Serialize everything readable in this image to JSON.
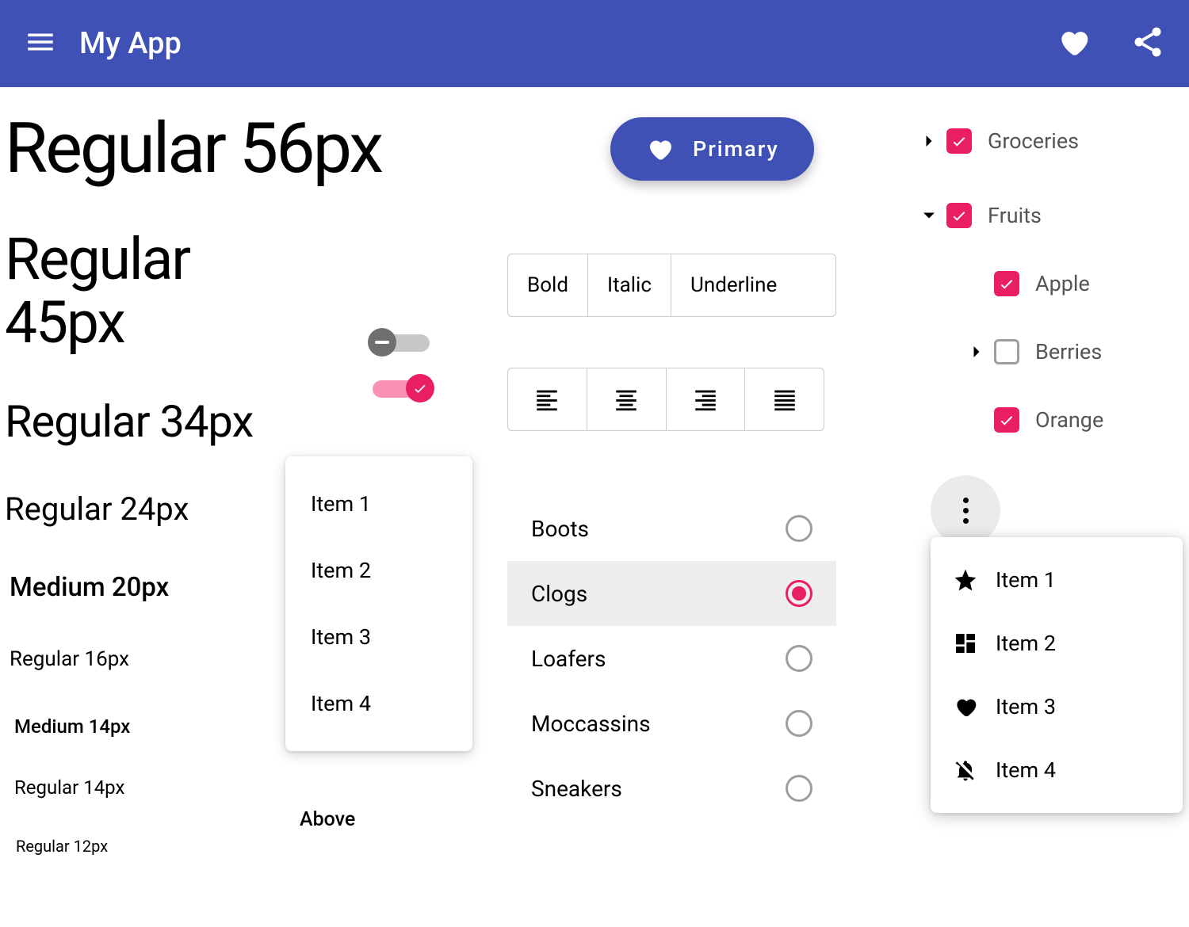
{
  "appbar": {
    "title": "My App"
  },
  "typography": {
    "t56": "Regular 56px",
    "t45": "Regular 45px",
    "t34": "Regular 34px",
    "t24": "Regular 24px",
    "t20": "Medium 20px",
    "t16": "Regular 16px",
    "t14m": "Medium 14px",
    "t14": "Regular 14px",
    "t12": "Regular 12px"
  },
  "toggles": {
    "off": false,
    "on": true
  },
  "simple_menu": {
    "items": [
      "Item 1",
      "Item 2",
      "Item 3",
      "Item 4"
    ],
    "position_label": "Above"
  },
  "primary_button": {
    "label": "Primary"
  },
  "format_toggle": {
    "items": [
      "Bold",
      "Italic",
      "Underline"
    ]
  },
  "align_toggle": {
    "items": [
      "left",
      "center",
      "right",
      "justify"
    ]
  },
  "radio_list": {
    "items": [
      "Boots",
      "Clogs",
      "Loafers",
      "Moccassins",
      "Sneakers"
    ],
    "selected": "Clogs"
  },
  "tree": {
    "root": {
      "label": "Groceries",
      "checked": true,
      "expanded": false
    },
    "fruits": {
      "label": "Fruits",
      "checked": true,
      "expanded": true
    },
    "children": [
      {
        "label": "Apple",
        "checked": true,
        "expandable": false
      },
      {
        "label": "Berries",
        "checked": false,
        "expandable": true,
        "expanded": false
      },
      {
        "label": "Orange",
        "checked": true,
        "expandable": false
      }
    ]
  },
  "overflow_menu": {
    "items": [
      "Item 1",
      "Item 2",
      "Item 3",
      "Item 4"
    ]
  }
}
